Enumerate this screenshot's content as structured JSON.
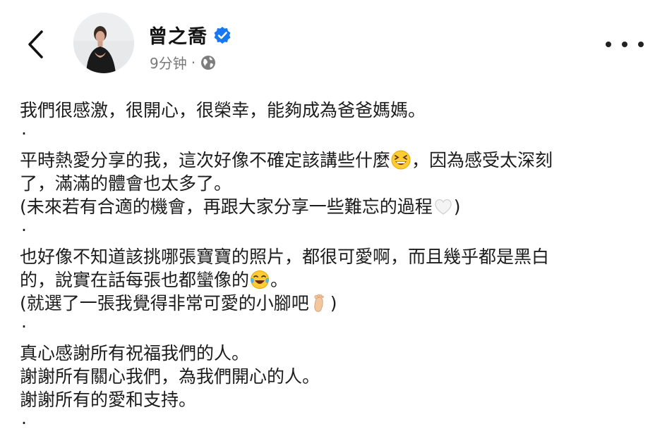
{
  "header": {
    "back_icon": "chevron-left-icon",
    "author_name": "曾之喬",
    "verified_icon": "verified-badge-icon",
    "verified_color": "#1877f2",
    "time": "9分钟",
    "separator": "·",
    "audience_icon": "globe-icon",
    "more_icon": "more-options-icon"
  },
  "post": {
    "l1": "我們很感激，很開心，很榮幸，能夠成為爸爸媽媽。",
    "d1": "·",
    "l2a": "平時熱愛分享的我，這次好像不確定該講些什麼",
    "l2b": "，因為感受太深刻",
    "l3": "了，滿滿的體會也太多了。",
    "l4a": "(未來若有合適的機會，再跟大家分享一些難忘的過程",
    "l4b": ")",
    "d2": "·",
    "l5": "也好像不知道該挑哪張寶寶的照片，都很可愛啊，而且幾乎都是黑白",
    "l6a": "的，說實在話每張也都蠻像的",
    "l6b": "。",
    "l7a": "(就選了一張我覺得非常可愛的小腳吧",
    "l7b": ")",
    "d3": "·",
    "l8": "真心感謝所有祝福我們的人。",
    "l9": "謝謝所有關心我們，為我們開心的人。",
    "l10": "謝謝所有的愛和支持。",
    "d4": "·",
    "emoji_icons": [
      "grinning-squinting-face-emoji",
      "white-heart-emoji",
      "face-with-tears-of-joy-emoji",
      "foot-emoji"
    ]
  }
}
